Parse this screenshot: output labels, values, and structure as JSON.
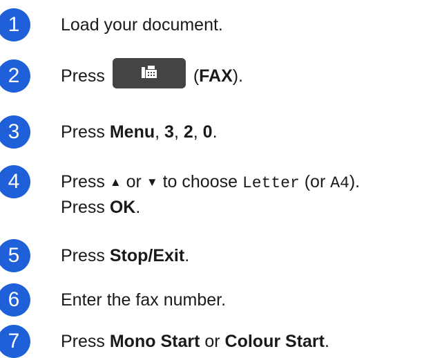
{
  "steps": [
    {
      "number": "1",
      "text": "Load your document."
    },
    {
      "number": "2",
      "pre": "Press",
      "paren_open": "(",
      "bold": "FAX",
      "post": ").",
      "button_icon": "fax-icon",
      "button_color": "#444444"
    },
    {
      "number": "3",
      "pre": "Press ",
      "b1": "Menu",
      "sep1": ", ",
      "b2": "3",
      "sep2": ", ",
      "b3": "2",
      "sep3": ", ",
      "b4": "0",
      "post": "."
    },
    {
      "number": "4",
      "pre": "Press ",
      "up": "▲",
      "mid": " or ",
      "down": "▼",
      "mid2": " to choose ",
      "mono1": "Letter",
      "mid3": " (or ",
      "mono2": "A4",
      "post": ").",
      "line2_pre": "Press ",
      "line2_bold": "OK",
      "line2_post": "."
    },
    {
      "number": "5",
      "pre": "Press ",
      "bold": "Stop/Exit",
      "post": "."
    },
    {
      "number": "6",
      "text": "Enter the fax number."
    },
    {
      "number": "7",
      "pre": "Press ",
      "b1": "Mono Start",
      "mid": " or ",
      "b2": "Colour Start",
      "post": "."
    }
  ],
  "colors": {
    "step_badge": "#1f5fd8",
    "text": "#1a1a1a"
  }
}
